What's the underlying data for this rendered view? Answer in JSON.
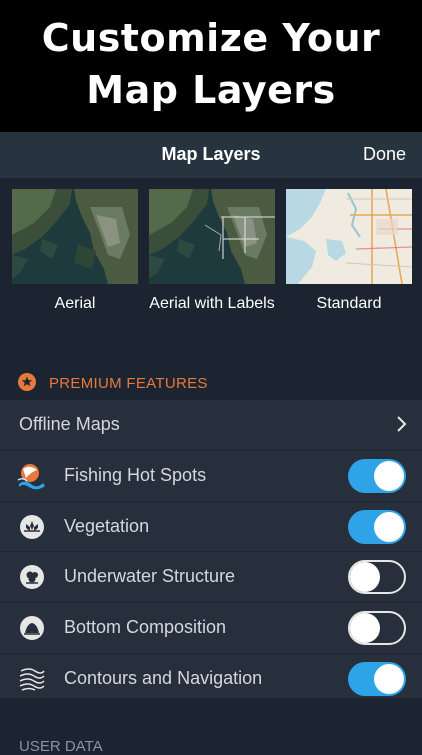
{
  "promo": {
    "line1": "Customize Your",
    "line2": "Map Layers"
  },
  "navbar": {
    "title": "Map Layers",
    "done_label": "Done"
  },
  "map_types": [
    {
      "label": "Aerial"
    },
    {
      "label": "Aerial with Labels"
    },
    {
      "label": "Standard"
    }
  ],
  "premium": {
    "header": "PREMIUM FEATURES",
    "offline_maps": "Offline Maps",
    "layers": [
      {
        "label": "Fishing Hot Spots",
        "enabled": true
      },
      {
        "label": "Vegetation",
        "enabled": true
      },
      {
        "label": "Underwater Structure",
        "enabled": false
      },
      {
        "label": "Bottom Composition",
        "enabled": false
      },
      {
        "label": "Contours and Navigation",
        "enabled": true
      }
    ]
  },
  "footer": {
    "header": "USER DATA"
  },
  "colors": {
    "accent": "#e8793c",
    "toggle_on": "#2fa3e8",
    "background": "#1b2430",
    "row_bg": "#262f3b"
  }
}
